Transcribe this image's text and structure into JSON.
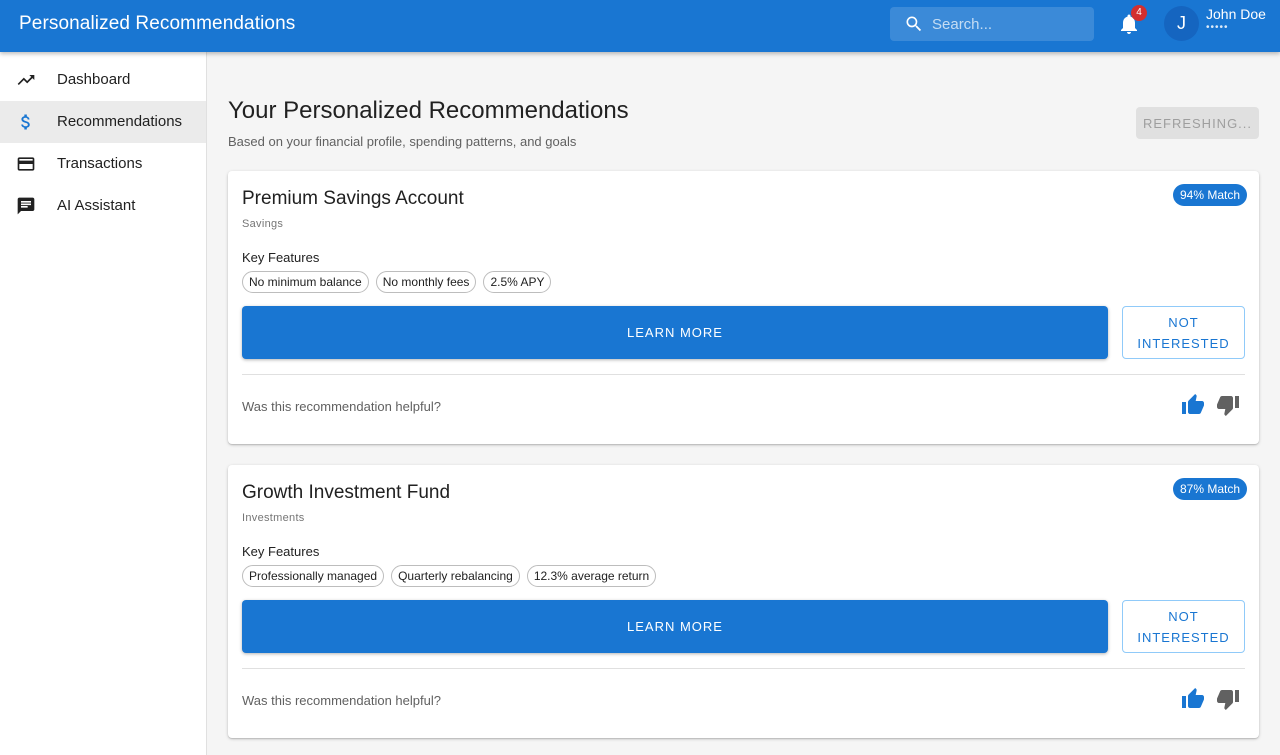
{
  "header": {
    "title": "Personalized Recommendations",
    "search_placeholder": "Search...",
    "notifications_count": "4",
    "user": {
      "initial": "J",
      "name": "John Doe",
      "subtitle": "•••••"
    }
  },
  "sidebar": {
    "items": [
      {
        "label": "Dashboard",
        "icon": "trending-up-icon",
        "active": false
      },
      {
        "label": "Recommendations",
        "icon": "dollar-icon",
        "active": true
      },
      {
        "label": "Transactions",
        "icon": "credit-card-icon",
        "active": false
      },
      {
        "label": "AI Assistant",
        "icon": "chat-icon",
        "active": false
      }
    ]
  },
  "main": {
    "title": "Your Personalized Recommendations",
    "subtitle": "Based on your financial profile, spending patterns, and goals",
    "refresh_label": "REFRESHING...",
    "cards": [
      {
        "title": "Premium Savings Account",
        "category": "Savings",
        "match": "94% Match",
        "features_label": "Key Features",
        "features": [
          "No minimum balance",
          "No monthly fees",
          "2.5% APY"
        ],
        "learn_more": "LEARN MORE",
        "not_interested": "NOT INTERESTED",
        "helpful_prompt": "Was this recommendation helpful?"
      },
      {
        "title": "Growth Investment Fund",
        "category": "Investments",
        "match": "87% Match",
        "features_label": "Key Features",
        "features": [
          "Professionally managed",
          "Quarterly rebalancing",
          "12.3% average return"
        ],
        "learn_more": "LEARN MORE",
        "not_interested": "NOT INTERESTED",
        "helpful_prompt": "Was this recommendation helpful?"
      }
    ]
  },
  "colors": {
    "primary": "#1976d2",
    "badge": "#d32f2f",
    "thumb_down": "#616161"
  }
}
